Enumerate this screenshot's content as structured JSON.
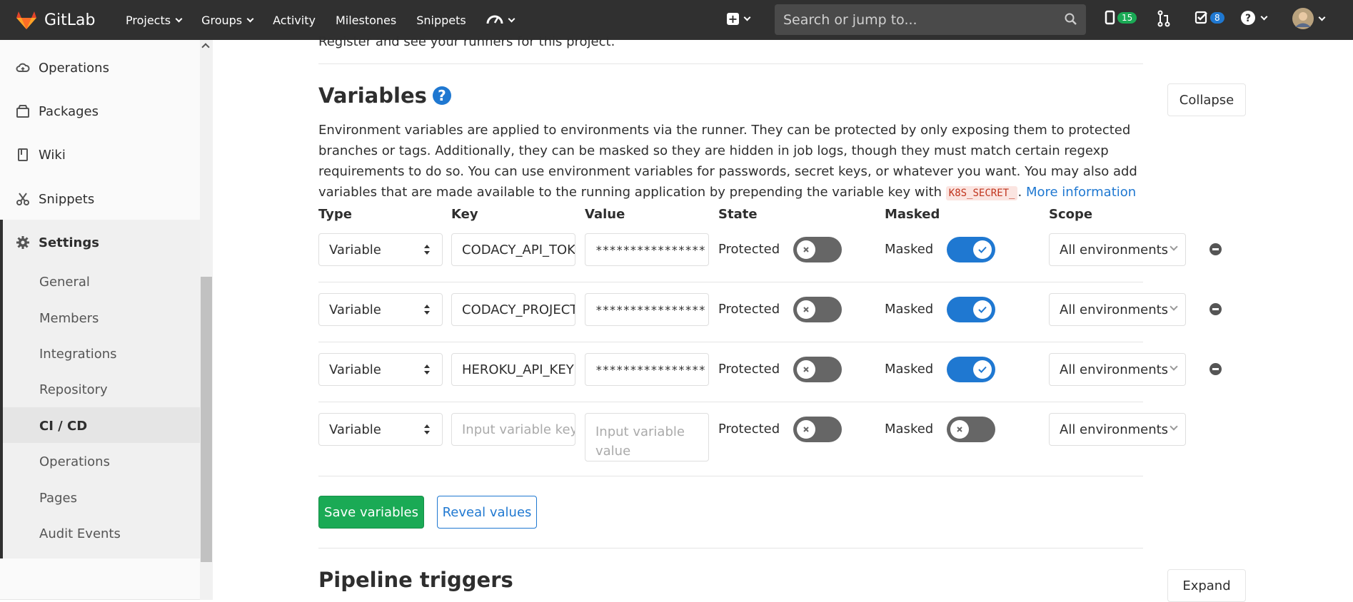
{
  "navbar": {
    "brand": "GitLab",
    "links": [
      "Projects",
      "Groups",
      "Activity",
      "Milestones",
      "Snippets"
    ],
    "search_placeholder": "Search or jump to...",
    "issues_count": "15",
    "todos_count": "8"
  },
  "sidebar": {
    "items": [
      "Operations",
      "Packages",
      "Wiki",
      "Snippets"
    ],
    "settings_label": "Settings",
    "sub_items": [
      "General",
      "Members",
      "Integrations",
      "Repository",
      "CI / CD",
      "Operations",
      "Pages",
      "Audit Events"
    ]
  },
  "main": {
    "cut_text": "Register and see your runners for this project.",
    "variables_title": "Variables",
    "collapse_label": "Collapse",
    "description_pre": "Environment variables are applied to environments via the runner. They can be protected by only exposing them to protected branches or tags. Additionally, they can be masked so they are hidden in job logs, though they must match certain regexp requirements to do so. You can use environment variables for passwords, secret keys, or whatever you want. You may also add variables that are made available to the running application by prepending the variable key with ",
    "description_code": "K8S_SECRET_",
    "description_post": ". ",
    "more_info": "More information",
    "columns": [
      "Type",
      "Key",
      "Value",
      "State",
      "Masked",
      "Scope"
    ],
    "rows": [
      {
        "type": "Variable",
        "key": "CODACY_API_TOKEN",
        "value": "****************",
        "state": "Protected",
        "masked": "Masked",
        "scope": "All environments"
      },
      {
        "type": "Variable",
        "key": "CODACY_PROJECT_TOKEN",
        "value": "****************",
        "state": "Protected",
        "masked": "Masked",
        "scope": "All environments"
      },
      {
        "type": "Variable",
        "key": "HEROKU_API_KEY",
        "value": "****************",
        "state": "Protected",
        "masked": "Masked",
        "scope": "All environments"
      },
      {
        "type": "Variable",
        "key_placeholder": "Input variable key",
        "value_placeholder": "Input variable value",
        "state": "Protected",
        "masked": "Masked",
        "scope": "All environments"
      }
    ],
    "save_label": "Save variables",
    "reveal_label": "Reveal values",
    "pipeline_title": "Pipeline triggers",
    "expand_label": "Expand"
  }
}
